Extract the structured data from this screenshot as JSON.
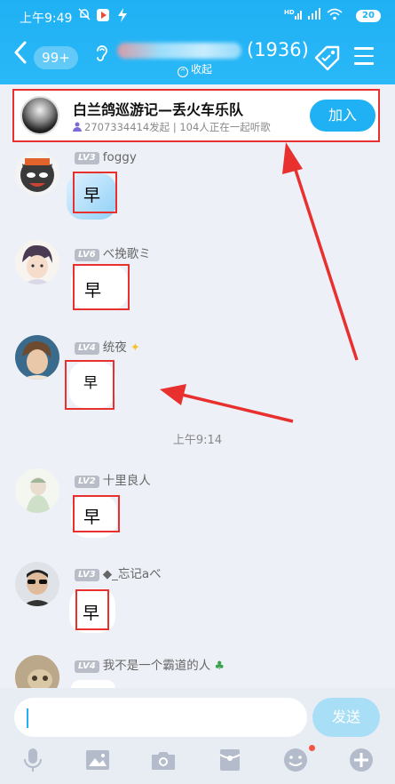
{
  "status_bar": {
    "time": "上午9:49",
    "battery": "20"
  },
  "header": {
    "back_badge": "99+",
    "member_count": "(1936)",
    "collapse_label": "收起"
  },
  "banner": {
    "title": "白兰鸽巡游记—丢火车乐队",
    "subtitle": "2707334414发起 | 104人正在一起听歌",
    "join_label": "加入"
  },
  "messages": [
    {
      "level": "LV3",
      "name": "foggy",
      "text": "早"
    },
    {
      "level": "LV6",
      "name": "べ挽歌ミ",
      "text": "早"
    },
    {
      "level": "LV4",
      "name": "统夜",
      "text": "早"
    },
    {
      "level": "LV2",
      "name": "十里良人",
      "text": "早"
    },
    {
      "level": "LV3",
      "name": "◆_忘记aべ",
      "text": "早"
    },
    {
      "level": "LV4",
      "name": "我不是一个霸道的人",
      "text": ""
    }
  ],
  "time_separator": "上午9:14",
  "input": {
    "value": "",
    "send_label": "发送"
  },
  "toolbar": {
    "icons": [
      "microphone-icon",
      "image-icon",
      "camera-icon",
      "red-packet-icon",
      "emoji-icon",
      "plus-icon"
    ]
  },
  "colors": {
    "header": "#1fb1f4",
    "annotation_red": "#e8302f",
    "send_disabled": "#a8dff7",
    "background": "#edf1f7"
  }
}
